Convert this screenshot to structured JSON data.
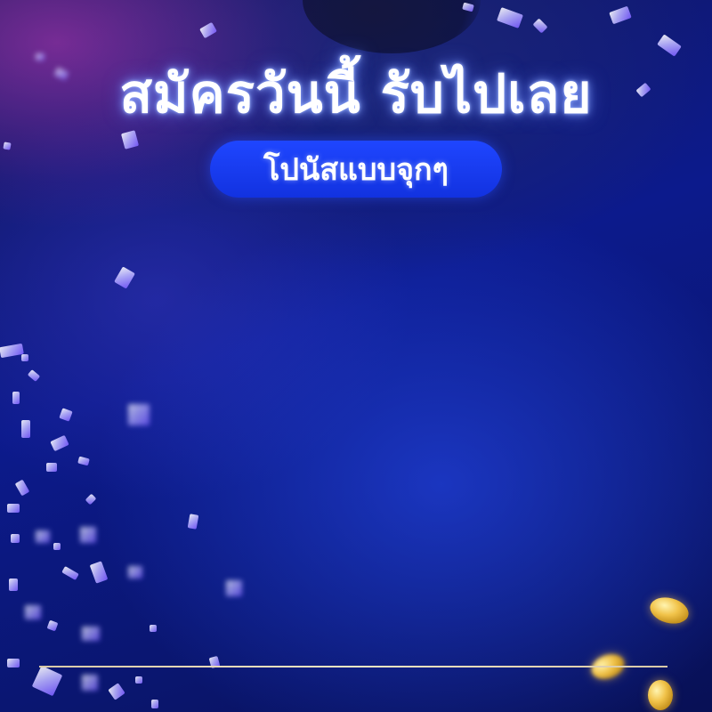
{
  "banner": {
    "headline": "สมัครวันนี้ รับไปเลย",
    "subheadline": "โปนัสแบบจุกๆ"
  },
  "colors": {
    "background": "#0c1a8c",
    "pill": "#1f46ff",
    "text": "#ffffff",
    "divider": "#f3e6c4",
    "coin": "#f1c34a"
  },
  "decorations": {
    "confetti": "confetti-pieces",
    "coins": "gold-coins"
  }
}
